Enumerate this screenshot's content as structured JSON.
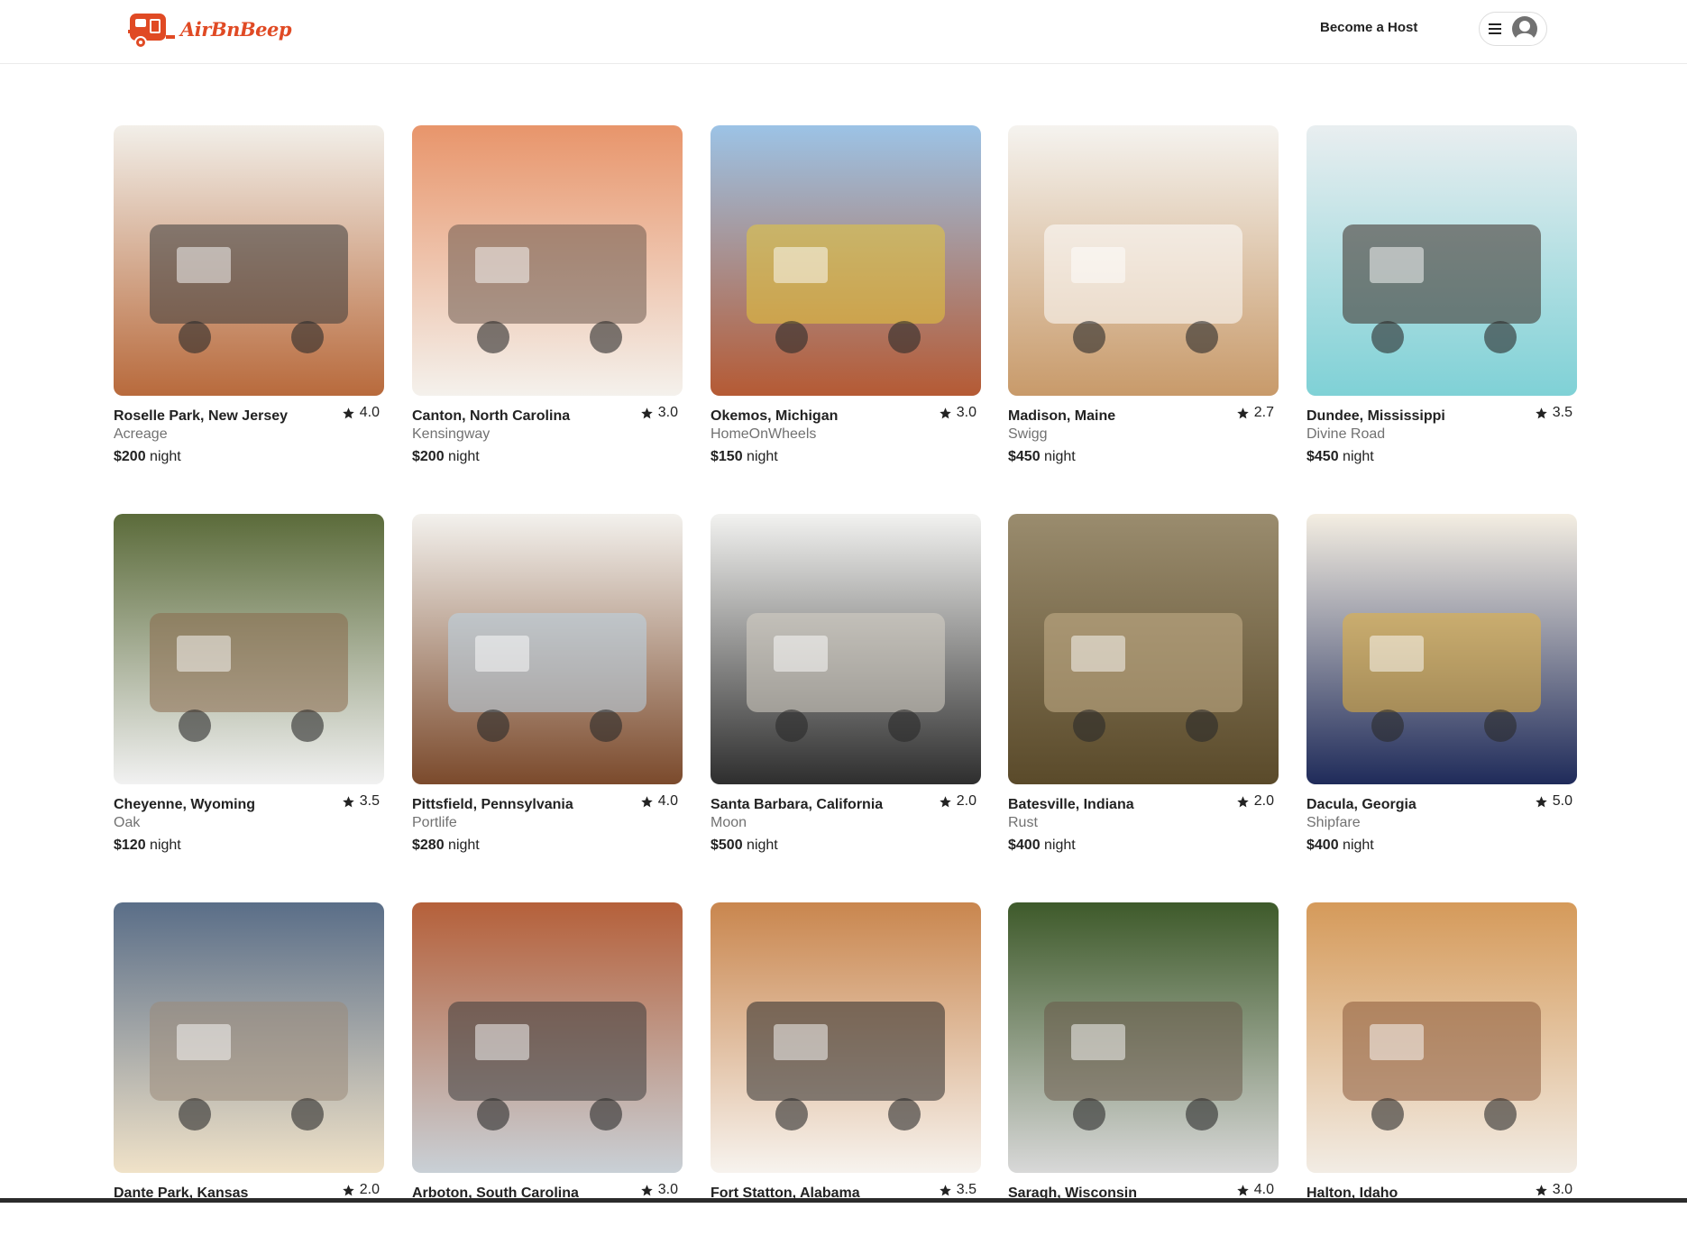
{
  "header": {
    "logo_text": "AirBnBeep",
    "become_host_label": "Become a Host",
    "menu_icon": "hamburger-menu-icon",
    "avatar_icon": "user-avatar-icon",
    "brand_color": "#e04a24"
  },
  "price_unit": "night",
  "listings": [
    {
      "location": "Roselle Park, New Jersey",
      "rating": "4.0",
      "host": "Acreage",
      "price": "$200"
    },
    {
      "location": "Canton, North Carolina",
      "rating": "3.0",
      "host": "Kensingway",
      "price": "$200"
    },
    {
      "location": "Okemos, Michigan",
      "rating": "3.0",
      "host": "HomeOnWheels",
      "price": "$150"
    },
    {
      "location": "Madison, Maine",
      "rating": "2.7",
      "host": "Swigg",
      "price": "$450"
    },
    {
      "location": "Dundee, Mississippi",
      "rating": "3.5",
      "host": "Divine Road",
      "price": "$450"
    },
    {
      "location": "Cheyenne, Wyoming",
      "rating": "3.5",
      "host": "Oak",
      "price": "$120"
    },
    {
      "location": "Pittsfield, Pennsylvania",
      "rating": "4.0",
      "host": "Portlife",
      "price": "$280"
    },
    {
      "location": "Santa Barbara, California",
      "rating": "2.0",
      "host": "Moon",
      "price": "$500"
    },
    {
      "location": "Batesville, Indiana",
      "rating": "2.0",
      "host": "Rust",
      "price": "$400"
    },
    {
      "location": "Dacula, Georgia",
      "rating": "5.0",
      "host": "Shipfare",
      "price": "$400"
    },
    {
      "location": "Dante Park, Kansas",
      "rating": "2.0",
      "host": "",
      "price": ""
    },
    {
      "location": "Arboton, South Carolina",
      "rating": "3.0",
      "host": "",
      "price": ""
    },
    {
      "location": "Fort Statton, Alabama",
      "rating": "3.5",
      "host": "",
      "price": ""
    },
    {
      "location": "Saragh, Wisconsin",
      "rating": "4.0",
      "host": "",
      "price": ""
    },
    {
      "location": "Halton, Idaho",
      "rating": "3.0",
      "host": "",
      "price": ""
    }
  ]
}
